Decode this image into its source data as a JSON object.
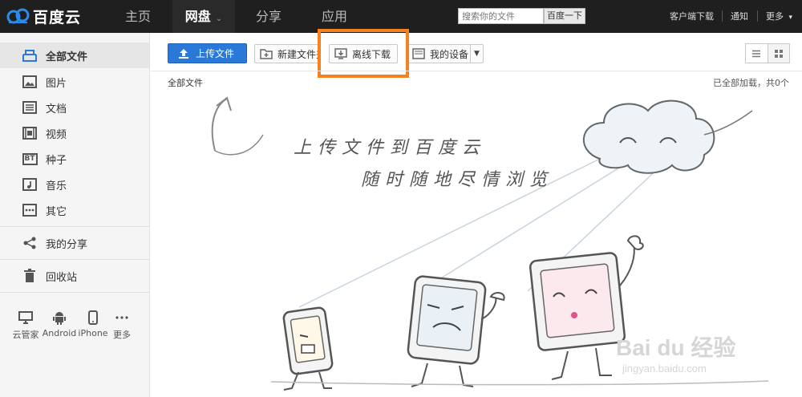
{
  "brand": {
    "name": "百度云"
  },
  "nav": [
    {
      "label": "主页",
      "active": false
    },
    {
      "label": "网盘",
      "active": true,
      "caret": "⌄"
    },
    {
      "label": "分享",
      "active": false
    },
    {
      "label": "应用",
      "active": false
    }
  ],
  "search": {
    "placeholder": "搜索你的文件",
    "button": "百度一下"
  },
  "top_links": [
    "客户端下载",
    "通知",
    "更多"
  ],
  "sidebar": {
    "items": [
      {
        "label": "全部文件",
        "icon": "folder-icon",
        "active": true
      },
      {
        "label": "图片",
        "icon": "image-icon"
      },
      {
        "label": "文档",
        "icon": "document-icon"
      },
      {
        "label": "视频",
        "icon": "film-icon"
      },
      {
        "label": "种子",
        "icon": "bt-icon",
        "badge": "BT"
      },
      {
        "label": "音乐",
        "icon": "music-icon"
      },
      {
        "label": "其它",
        "icon": "more-icon"
      },
      {
        "label": "我的分享",
        "icon": "share-icon"
      },
      {
        "label": "回收站",
        "icon": "trash-icon"
      }
    ],
    "devices": [
      {
        "label": "云管家",
        "icon": "monitor-icon"
      },
      {
        "label": "Android",
        "icon": "android-icon"
      },
      {
        "label": "iPhone",
        "icon": "phone-icon"
      },
      {
        "label": "更多",
        "icon": "more-dots-icon"
      }
    ]
  },
  "toolbar": {
    "upload": "上传文件",
    "new_folder": "新建文件夹",
    "offline_download": "离线下载",
    "my_devices": "我的设备"
  },
  "breadcrumb": "全部文件",
  "status": "已全部加载，共0个",
  "illustration": {
    "line1": "上传文件到百度云",
    "line2": "随时随地尽情浏览"
  },
  "watermark": {
    "main": "Bai du 经验",
    "sub": "jingyan.baidu.com"
  },
  "colors": {
    "accent": "#2a79d8",
    "highlight": "#f5821f",
    "topbar": "#1f1f1f"
  }
}
